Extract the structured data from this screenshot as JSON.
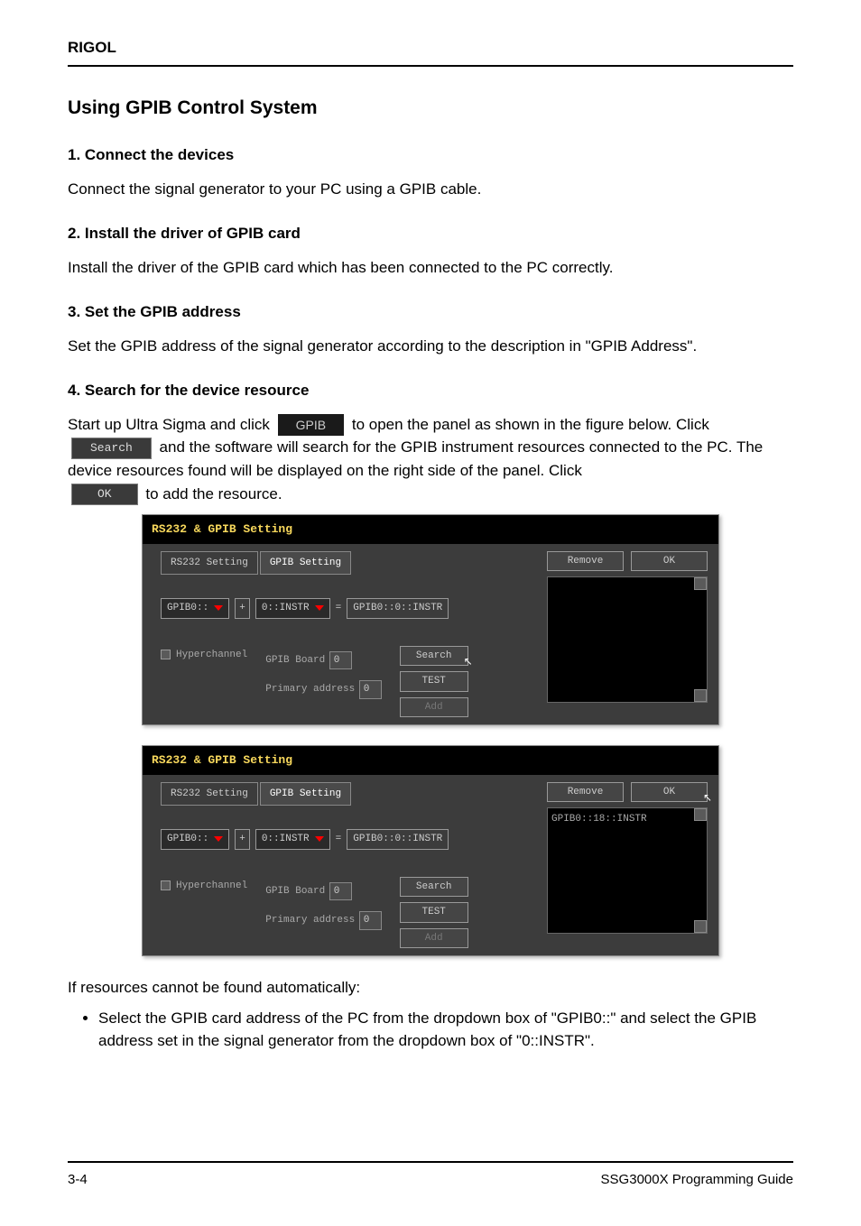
{
  "header": {
    "brand": "RIGOL"
  },
  "section1": {
    "title": "Using GPIB Control System",
    "intro_heading": "1. Connect the devices",
    "intro_body": "Connect the signal generator to your PC using a GPIB cable.",
    "step2_heading": "2. Install the driver of GPIB card",
    "step2_body": "Install the driver of the GPIB card which has been connected to the PC correctly."
  },
  "section3": {
    "heading": "3. Set the GPIB address",
    "body": "Set the GPIB address of the signal generator according to the description in \"GPIB Address\".",
    "link_text": "GPIB Address"
  },
  "section4": {
    "heading": "4. Search for the device resource",
    "body1_prefix": "Start up Ultra Sigma and click ",
    "gpib_btn": "GPIB",
    "body1_suffix": " to open the panel as shown in the figure below. Click ",
    "search_btn": "Search",
    "body2": " and the software will search for the GPIB instrument resources connected to the PC. The device resources found will be displayed on the right side of the panel. Click ",
    "ok_btn": "OK",
    "body3": " to add the resource."
  },
  "dialog": {
    "title": "RS232 & GPIB Setting",
    "tabs": {
      "rs232": "RS232 Setting",
      "gpib": "GPIB Setting"
    },
    "board_prefix": "GPIB0::",
    "instr_value": "0::INSTR",
    "result_value": "GPIB0::0::INSTR",
    "hyperchannel": "Hyperchannel",
    "gpib_board_label": "GPIB Board",
    "gpib_board_value": "0",
    "primary_addr_label": "Primary address",
    "primary_addr_value": "0",
    "buttons": {
      "search": "Search",
      "test": "TEST",
      "add": "Add",
      "remove": "Remove",
      "ok": "OK"
    },
    "found_item": "GPIB0::18::INSTR"
  },
  "notfound": {
    "heading": "If resources cannot be found automatically:",
    "bullet1": "Select the GPIB card address of the PC from the dropdown box of \"GPIB0::\" and select the GPIB address set in the signal generator from the dropdown box of \"0::INSTR\"."
  },
  "footer": {
    "page": "3-4",
    "doc": "SSG3000X Programming Guide"
  }
}
